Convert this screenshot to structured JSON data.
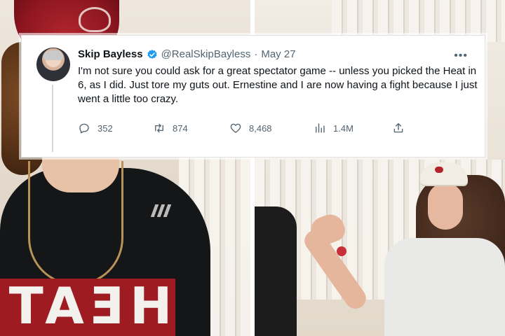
{
  "tweet": {
    "display_name": "Skip Bayless",
    "handle": "@RealSkipBayless",
    "separator": "·",
    "date": "May 27",
    "text": "I'm not sure you could ask for a great spectator game -- unless you picked the Heat in 6, as I did. Just tore my guts out. Ernestine and I are now having a fight because I just went a little too crazy.",
    "stats": {
      "replies": "352",
      "retweets": "874",
      "likes": "8,468",
      "views": "1.4M"
    },
    "verified_color": "#1d9bf0",
    "icons": {
      "more": "more-icon",
      "reply": "reply-icon",
      "retweet": "retweet-icon",
      "like": "heart-icon",
      "views": "views-icon",
      "share": "share-icon"
    }
  },
  "background": {
    "shirt_text": "HEAT",
    "colors": {
      "heat_red": "#9f1b22",
      "shirt_black": "#151617"
    }
  }
}
